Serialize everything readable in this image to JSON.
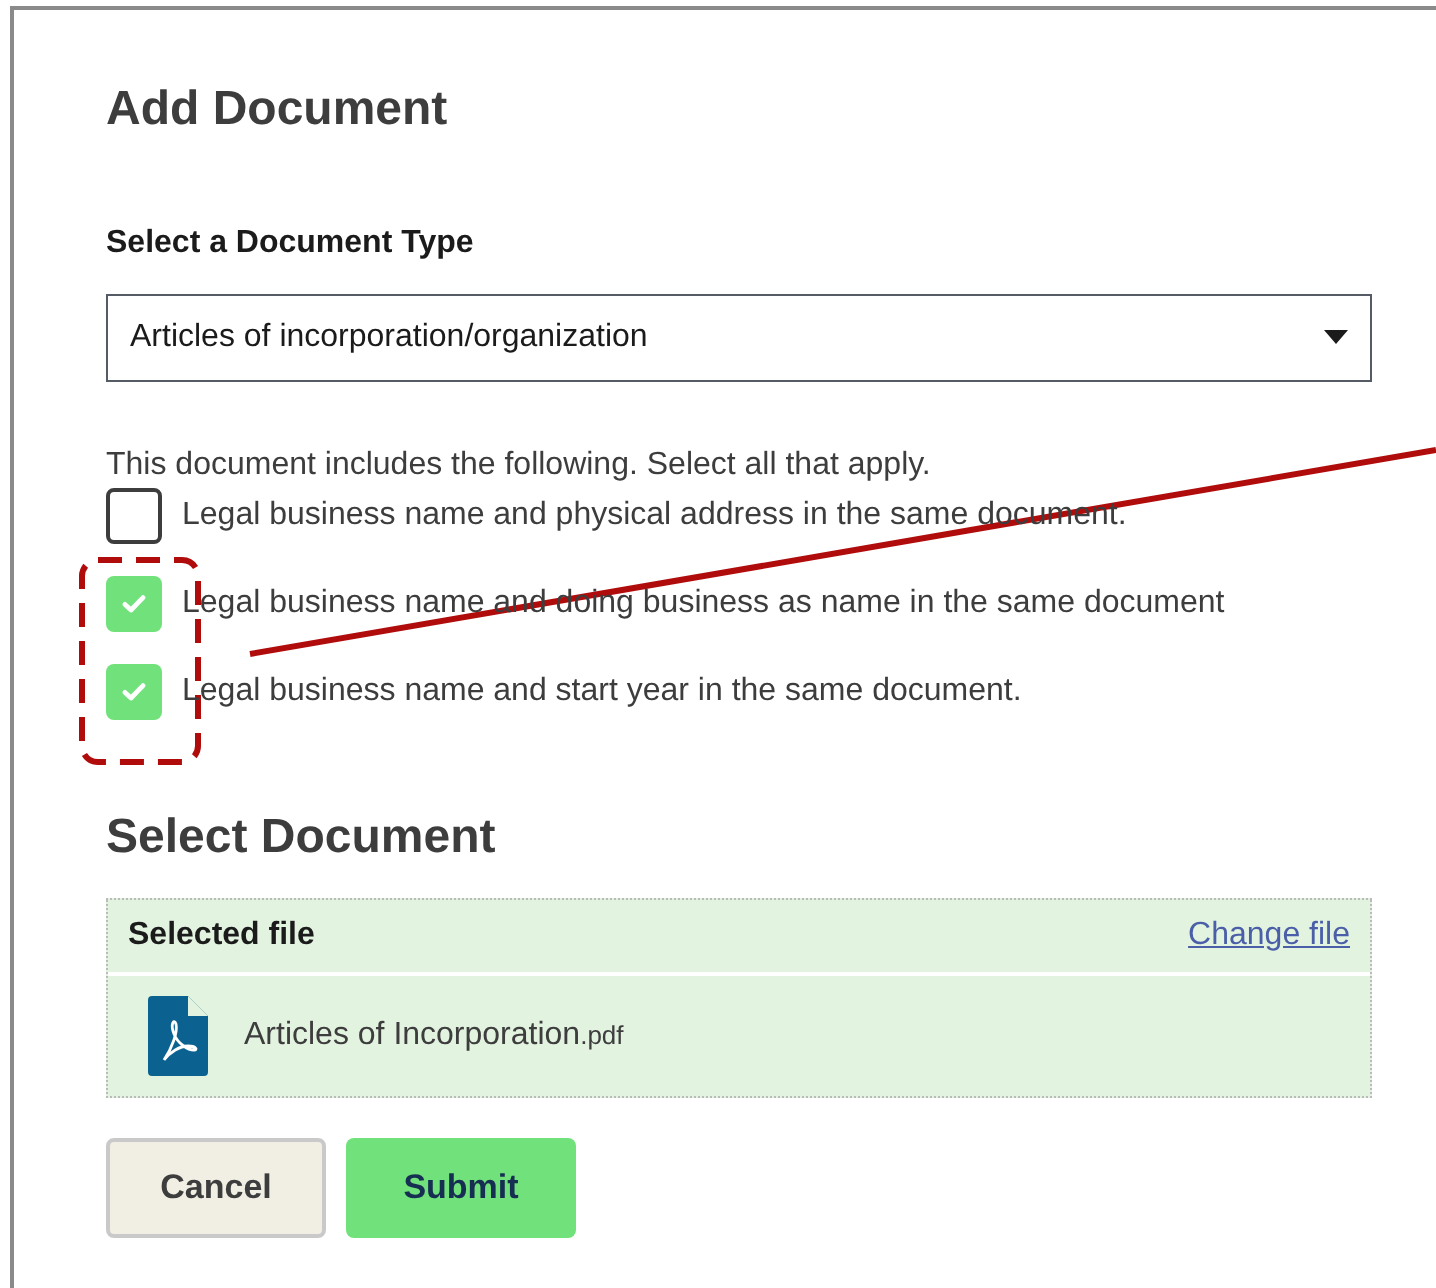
{
  "dialog": {
    "title": "Add Document"
  },
  "document_type": {
    "label": "Select a Document Type",
    "value": "Articles of incorporation/organization"
  },
  "includes": {
    "prompt": "This document includes the following. Select all that apply.",
    "options": [
      {
        "label": "Legal business name and physical address in the same document.",
        "checked": false
      },
      {
        "label": "Legal business name and doing business as name in the same document",
        "checked": true
      },
      {
        "label": "Legal business name and start year in the same document.",
        "checked": true
      }
    ]
  },
  "select_document": {
    "heading": "Select Document",
    "header": "Selected file",
    "change_link": "Change file",
    "file": {
      "name": "Articles of Incorporation",
      "extension": ".pdf"
    }
  },
  "buttons": [
    {
      "label": "Cancel",
      "kind": "secondary"
    },
    {
      "label": "Submit",
      "kind": "primary"
    }
  ]
}
